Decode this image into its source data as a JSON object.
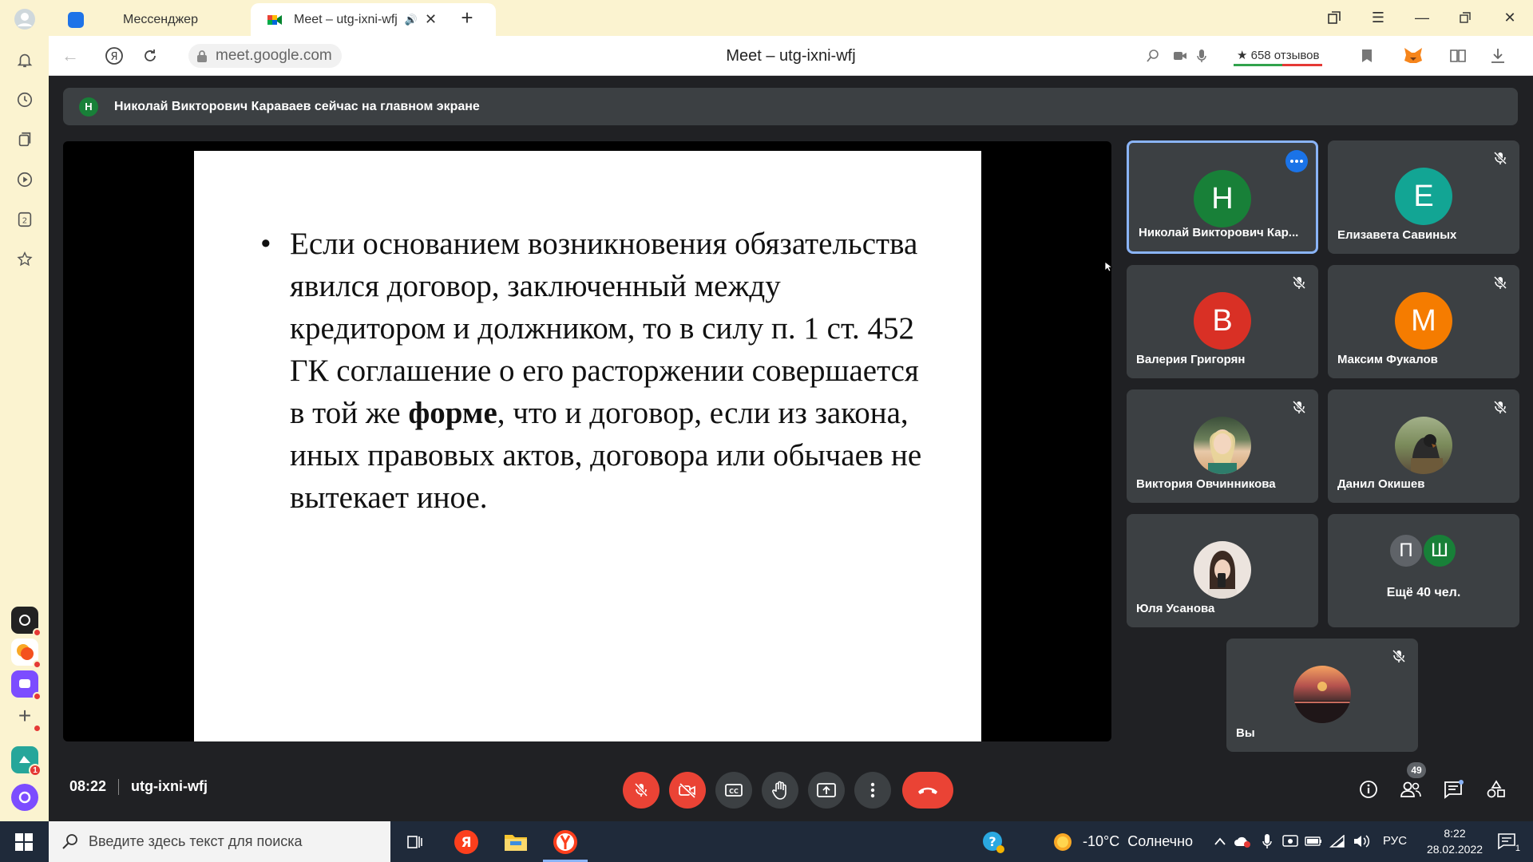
{
  "browser": {
    "tabs": [
      {
        "label": "Мессенджер"
      },
      {
        "label": "Meet – utg-ixni-wfj"
      }
    ],
    "url": "meet.google.com",
    "page_title": "Meet – utg-ixni-wfj",
    "reviews": "★ 658 отзывов"
  },
  "meet": {
    "banner": {
      "avatar_letter": "Н",
      "text": "Николай Викторович Караваев сейчас на главном экране"
    },
    "slide": {
      "bullet": "•",
      "text_before": "Если основанием возникновения обязательства явился договор, заключенный между кредитором и должником, то в силу п. 1 ст. 452 ГК соглашение о его расторжении совершается в той же ",
      "text_bold": "форме",
      "text_after": ", что и договор, если из закона, иных правовых актов, договора или обычаев не вытекает иное."
    },
    "participants": [
      {
        "name": "Николай Викторович Кар...",
        "letter": "Н",
        "color": "#188038"
      },
      {
        "name": "Елизавета Савиных",
        "letter": "Е",
        "color": "#12a594"
      },
      {
        "name": "Валерия Григорян",
        "letter": "В",
        "color": "#d93025"
      },
      {
        "name": "Максим Фукалов",
        "letter": "М",
        "color": "#f57c00"
      },
      {
        "name": "Виктория Овчинникова",
        "letter": "",
        "color": "#8d6e63"
      },
      {
        "name": "Данил Окишев",
        "letter": "",
        "color": "#6d4c41"
      },
      {
        "name": "Юля Усанова",
        "letter": "",
        "color": "#e0d6d0"
      },
      {
        "name": "Вы",
        "letter": "",
        "color": "#5d4037"
      }
    ],
    "others": {
      "letters": [
        "П",
        "Ш"
      ],
      "label": "Ещё 40 чел."
    },
    "time": "08:22",
    "meeting_code": "utg-ixni-wfj",
    "people_count": "49"
  },
  "taskbar": {
    "search_placeholder": "Введите здесь текст для поиска",
    "weather": "-10°C  Солнечно",
    "lang": "РУС",
    "time": "8:22",
    "date": "28.02.2022",
    "notification_count": "1",
    "sidebar_badge": "1"
  },
  "colors": {
    "meet_bg": "#202124",
    "tile_bg": "#3c4043",
    "red": "#ea4335",
    "active_border": "#8ab4f8",
    "browser_chrome": "#fbf3d0"
  }
}
